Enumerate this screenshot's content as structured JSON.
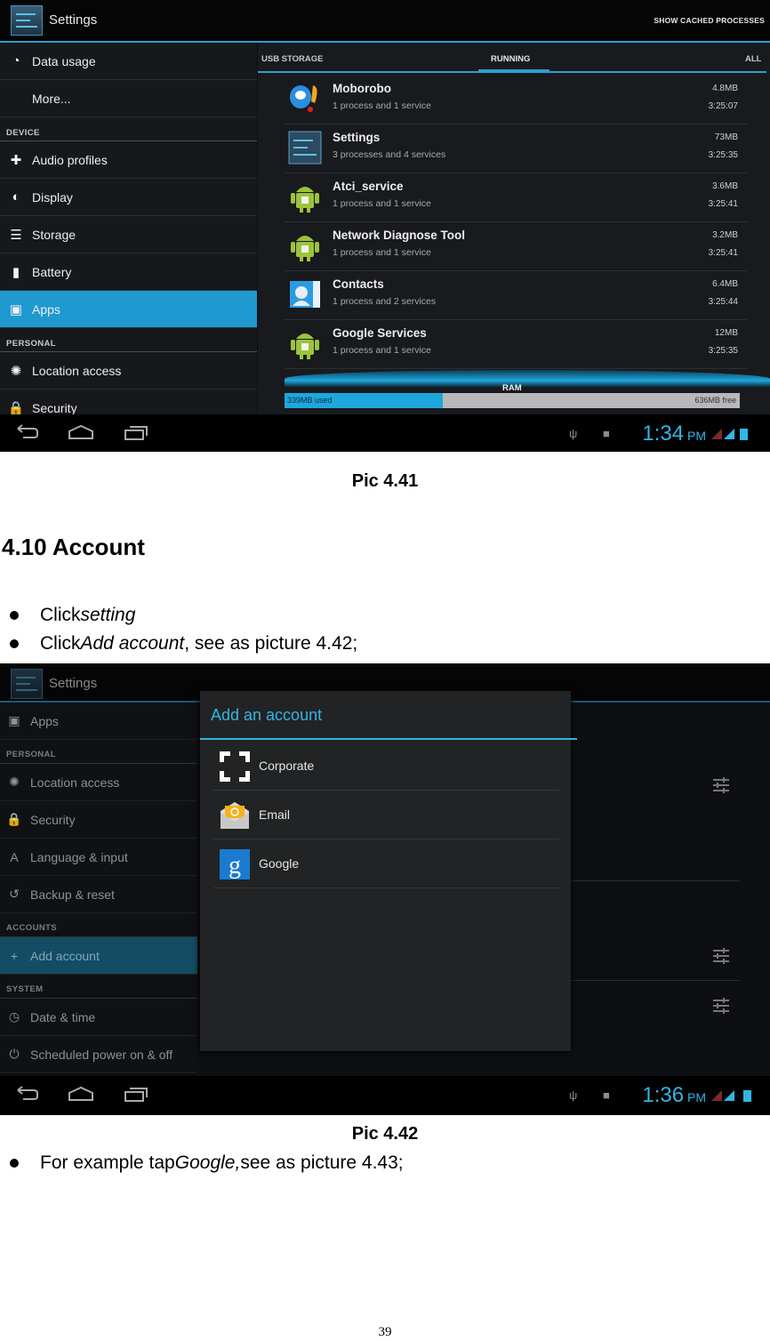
{
  "pic1": {
    "action_bar": {
      "title": "Settings",
      "action": "SHOW CACHED PROCESSES"
    },
    "sidebar": {
      "items": [
        {
          "type": "item",
          "label": "Data usage",
          "icon": "data-usage-icon"
        },
        {
          "type": "item",
          "label": "More...",
          "icon": ""
        },
        {
          "type": "header",
          "label": "DEVICE"
        },
        {
          "type": "item",
          "label": "Audio profiles",
          "icon": "audio-profiles-icon"
        },
        {
          "type": "item",
          "label": "Display",
          "icon": "display-icon"
        },
        {
          "type": "item",
          "label": "Storage",
          "icon": "storage-icon"
        },
        {
          "type": "item",
          "label": "Battery",
          "icon": "battery-icon"
        },
        {
          "type": "item",
          "label": "Apps",
          "icon": "apps-icon",
          "active": true
        },
        {
          "type": "header",
          "label": "PERSONAL"
        },
        {
          "type": "item",
          "label": "Location access",
          "icon": "location-icon"
        },
        {
          "type": "item",
          "label": "Security",
          "icon": "lock-icon"
        }
      ]
    },
    "tabs": [
      {
        "label": "USB STORAGE",
        "selected": false
      },
      {
        "label": "RUNNING",
        "selected": true
      },
      {
        "label": "ALL",
        "selected": false
      }
    ],
    "processes": [
      {
        "name": "Moborobo",
        "desc": "1 process and 1 service",
        "size": "4.8MB",
        "time": "3:25:07",
        "icon": "moborobo-icon"
      },
      {
        "name": "Settings",
        "desc": "3 processes and 4 services",
        "size": "73MB",
        "time": "3:25:35",
        "icon": "settings-icon"
      },
      {
        "name": "Atci_service",
        "desc": "1 process and 1 service",
        "size": "3.6MB",
        "time": "3:25:41",
        "icon": "android-icon"
      },
      {
        "name": "Network Diagnose Tool",
        "desc": "1 process and 1 service",
        "size": "3.2MB",
        "time": "3:25:41",
        "icon": "android-icon"
      },
      {
        "name": "Contacts",
        "desc": "1 process and 2 services",
        "size": "6.4MB",
        "time": "3:25:44",
        "icon": "contacts-icon"
      },
      {
        "name": "Google Services",
        "desc": "1 process and 1 service",
        "size": "12MB",
        "time": "3:25:35",
        "icon": "android-icon"
      }
    ],
    "ram": {
      "label": "RAM",
      "used": "339MB used",
      "free": "636MB free",
      "used_fraction": 0.348
    },
    "status": {
      "time": "1:34",
      "ampm": "PM"
    },
    "caption": "Pic 4.41"
  },
  "section": {
    "heading": "4.10 Account",
    "bullets": [
      {
        "prefix": "Click ",
        "emph": "setting",
        "suffix": ""
      },
      {
        "prefix": "Click ",
        "emph": "Add account",
        "suffix": ", see as picture 4.42;"
      }
    ]
  },
  "pic2": {
    "action_bar": {
      "title": "Settings"
    },
    "sidebar": {
      "items": [
        {
          "type": "item",
          "label": "Apps",
          "icon": "apps-icon"
        },
        {
          "type": "header",
          "label": "PERSONAL"
        },
        {
          "type": "item",
          "label": "Location access",
          "icon": "location-icon"
        },
        {
          "type": "item",
          "label": "Security",
          "icon": "lock-icon"
        },
        {
          "type": "item",
          "label": "Language & input",
          "icon": "language-icon"
        },
        {
          "type": "item",
          "label": "Backup & reset",
          "icon": "backup-icon"
        },
        {
          "type": "header",
          "label": "ACCOUNTS"
        },
        {
          "type": "item",
          "label": "Add account",
          "icon": "plus-icon",
          "active": true
        },
        {
          "type": "header",
          "label": "SYSTEM"
        },
        {
          "type": "item",
          "label": "Date & time",
          "icon": "clock-icon"
        },
        {
          "type": "item",
          "label": "Scheduled power on & off",
          "icon": "power-schedule-icon"
        }
      ]
    },
    "dialog": {
      "title": "Add an account",
      "options": [
        {
          "label": "Corporate",
          "icon": "corporate-icon"
        },
        {
          "label": "Email",
          "icon": "email-icon"
        },
        {
          "label": "Google",
          "icon": "google-icon"
        }
      ]
    },
    "status": {
      "time": "1:36",
      "ampm": "PM"
    },
    "caption": "Pic 4.42"
  },
  "footer_bullet": {
    "prefix": "For example tap ",
    "emph": "Google,",
    "suffix": " see as picture 4.43;"
  },
  "page_number": "39",
  "colors": {
    "accent": "#33b5e5",
    "selected_item": "#1e9ad0"
  }
}
